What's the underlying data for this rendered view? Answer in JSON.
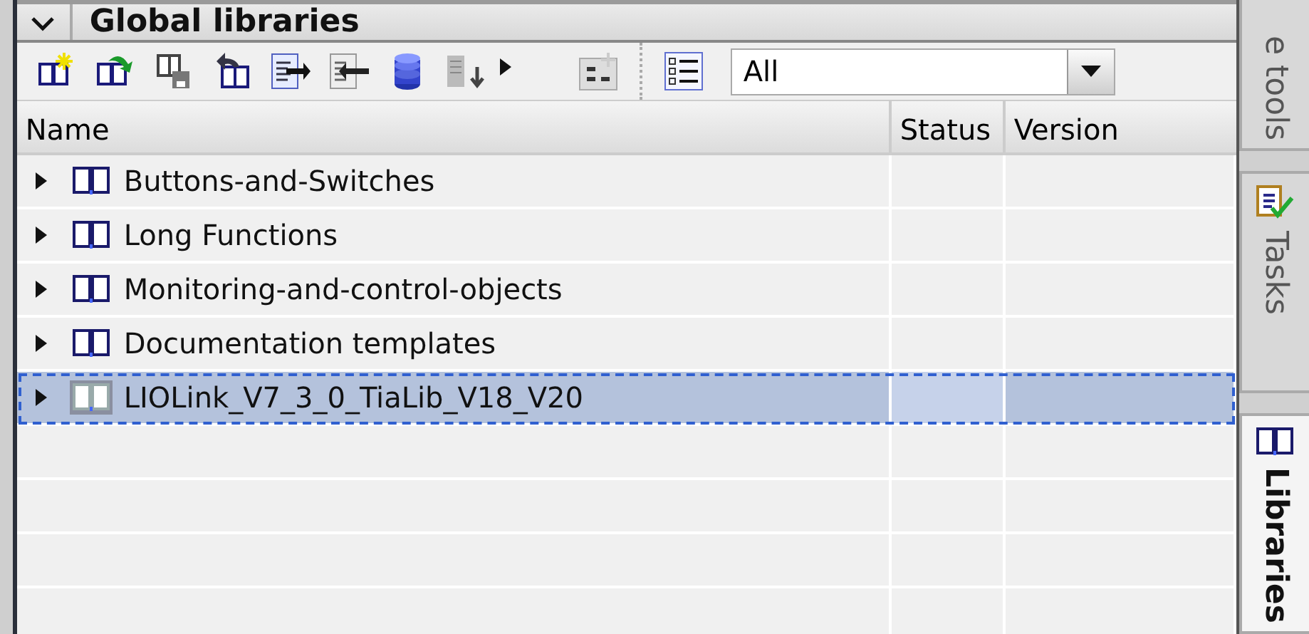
{
  "panel": {
    "title": "Global libraries",
    "expanded": true
  },
  "toolbar": {
    "filter": {
      "value": "All"
    }
  },
  "table": {
    "columns": [
      "Name",
      "Status",
      "Version"
    ],
    "rows": [
      {
        "name": "Buttons-and-Switches",
        "expanded": false,
        "selected": false
      },
      {
        "name": "Long Functions",
        "expanded": false,
        "selected": false
      },
      {
        "name": "Monitoring-and-control-objects",
        "expanded": false,
        "selected": false
      },
      {
        "name": "Documentation templates",
        "expanded": false,
        "selected": false
      },
      {
        "name": "LIOLink_V7_3_0_TiaLib_V18_V20",
        "expanded": false,
        "selected": true
      }
    ]
  },
  "side_tabs": [
    {
      "label": "e tools",
      "kind": "tools",
      "selected": false
    },
    {
      "label": "Tasks",
      "kind": "tasks",
      "selected": false
    },
    {
      "label": "Libraries",
      "kind": "libraries",
      "selected": true
    }
  ]
}
